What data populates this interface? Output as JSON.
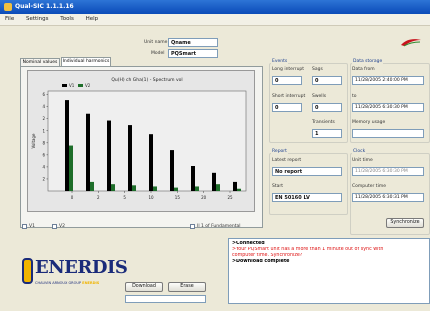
{
  "window": {
    "title": "Qual-SIC 1.1.1.16"
  },
  "menu": [
    "File",
    "Settings",
    "Tools",
    "Help"
  ],
  "header": {
    "unit_name_label": "Unit name",
    "unit_name_value": "Qname",
    "model_label": "Model",
    "model_value": "PQSmart"
  },
  "tabs": [
    {
      "label": "Nominal values"
    },
    {
      "label": "Individual harmonics"
    }
  ],
  "chart_data": {
    "type": "bar",
    "title": "Qu(H) ch Gha(1) - Spectrum vol",
    "ylabel": "Voltage",
    "legend": [
      "V1",
      "V2"
    ],
    "legend_placement": "top-left",
    "x_ticks": [
      "0",
      "2",
      "5",
      "10",
      "15",
      "20",
      "25"
    ],
    "y_ticks": [
      "2",
      "4",
      "6",
      "8",
      "1",
      "2",
      "4",
      "6"
    ],
    "ylim": [
      0,
      8.8
    ],
    "series": [
      {
        "name": "V1",
        "color": "#000000",
        "values": [
          8.0,
          6.8,
          6.2,
          5.8,
          5.0,
          3.6,
          2.2,
          1.6,
          0.8
        ]
      },
      {
        "name": "V2",
        "color": "#1e6e2a",
        "values": [
          4.0,
          0.8,
          0.6,
          0.5,
          0.4,
          0.3,
          0.4,
          0.6,
          0.2
        ]
      }
    ]
  },
  "chart_options": [
    {
      "label": "V1"
    },
    {
      "label": "V2"
    },
    {
      "label": "Il 1 of Fundamental"
    }
  ],
  "events": {
    "title": "Events",
    "long_interrupt_label": "Long interrupt",
    "long_interrupt_value": "0",
    "sags_label": "Sags",
    "sags_value": "0",
    "short_interrupt_label": "Short interrupt",
    "short_interrupt_value": "0",
    "swells_label": "Swells",
    "swells_value": "0",
    "transients_label": "Transients",
    "transients_value": "1"
  },
  "data_storage": {
    "title": "Data storage",
    "data_from_label": "Data from",
    "data_from_value": "11/28/2005 2:40:00 PM",
    "to_label": "to",
    "to_value": "11/28/2005 6:30:30 PM",
    "memory_usage_label": "Memory usage",
    "memory_usage_value": ""
  },
  "report": {
    "title": "Report",
    "latest_report_label": "Latest report",
    "latest_report_value": "No report",
    "start_label": "Start",
    "start_value": "EN 50160 LV"
  },
  "clock": {
    "title": "Clock",
    "unit_time_label": "Unit time",
    "unit_time_value": "11/28/2005 6:30:30 PM",
    "computer_time_label": "Computer time",
    "computer_time_value": "11/28/2005 6:30:31 PM",
    "synchronize_label": "Synchronize"
  },
  "log": [
    {
      "text": ">Connected",
      "style": "ok"
    },
    {
      "text": ">Your PQSmart unit has a more than 1 minute out of sync with",
      "style": "err"
    },
    {
      "text": "computer time. Synchronize?",
      "style": "err"
    },
    {
      "text": ">Download complete",
      "style": "ok"
    }
  ],
  "buttons": {
    "download_label": "Download",
    "erase_label": "Erase"
  },
  "logo": {
    "name": "ENERDIS",
    "sub_prefix": "CHAUVIN ARNOUX GROUP",
    "sub_suffix": "ENERDIS"
  },
  "colors": {
    "titlebar": "#0b4bb8",
    "series1": "#000000",
    "series2": "#1e6e2a",
    "error_text": "#d11111",
    "logo_blue": "#1a2b7a",
    "logo_yellow": "#f0b400"
  }
}
